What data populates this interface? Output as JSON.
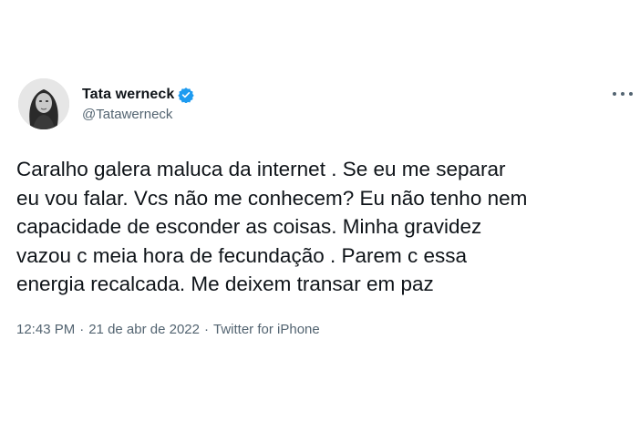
{
  "author": {
    "display_name": "Tata werneck",
    "handle": "@Tatawerneck",
    "avatar_icon": "person-avatar",
    "verified_icon": "verified-badge-icon",
    "verified_color": "#1d9bf0"
  },
  "more_icon": "more-horizontal-icon",
  "tweet": {
    "text": "Caralho galera maluca da internet . Se eu me separar\neu vou falar. Vcs não me conhecem? Eu não tenho nem\ncapacidade de esconder as coisas. Minha gravidez\nvazou c meia hora de fecundação . Parem c essa\nenergia recalcada. Me deixem transar em paz"
  },
  "meta": {
    "time": "12:43 PM",
    "date": "21 de abr de 2022",
    "separator": "·",
    "source": "Twitter for iPhone"
  },
  "colors": {
    "text_primary": "#0f1419",
    "text_secondary": "#536471",
    "background": "#ffffff"
  }
}
